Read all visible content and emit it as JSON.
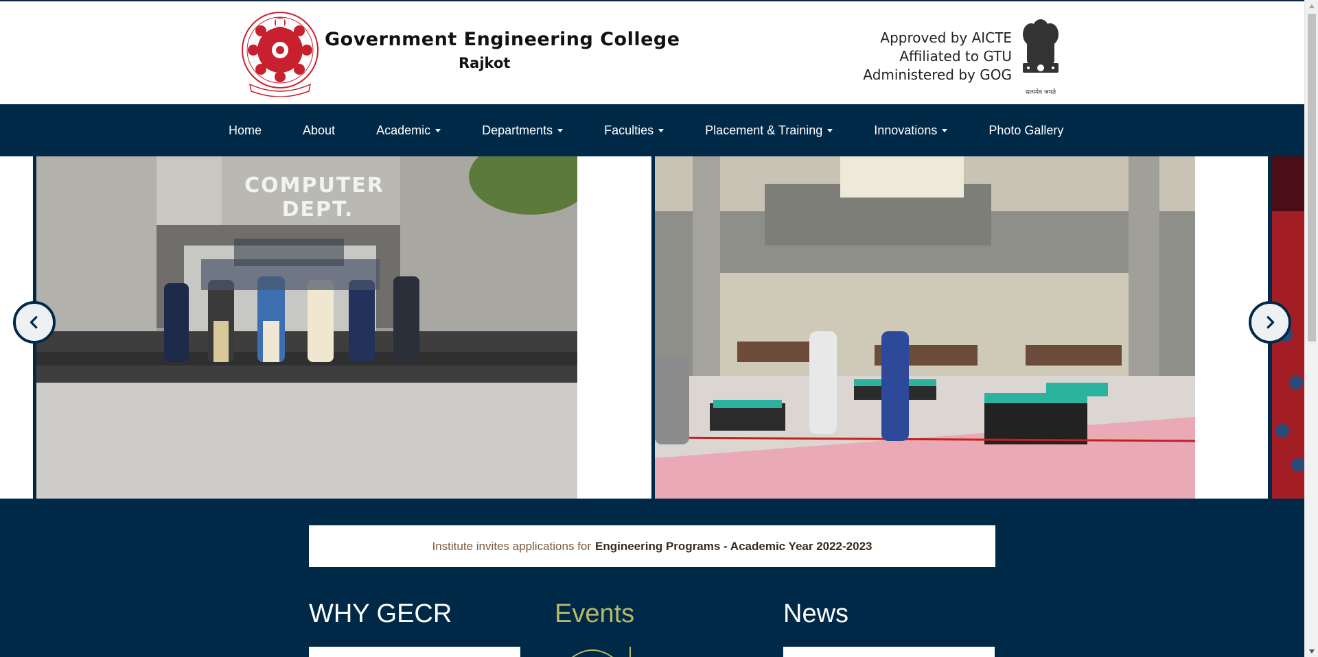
{
  "header": {
    "college_name": "Government Engineering College",
    "college_city": "Rajkot",
    "approvals": [
      "Approved by AICTE",
      "Affiliated to GTU",
      "Administered by GOG"
    ],
    "emblem_caption": "सत्यमेव जयते"
  },
  "nav": {
    "items": [
      {
        "label": "Home",
        "dropdown": false
      },
      {
        "label": "About",
        "dropdown": false
      },
      {
        "label": "Academic",
        "dropdown": true
      },
      {
        "label": "Departments",
        "dropdown": true
      },
      {
        "label": "Faculties",
        "dropdown": true
      },
      {
        "label": "Placement & Training",
        "dropdown": true
      },
      {
        "label": "Innovations",
        "dropdown": true
      },
      {
        "label": "Photo Gallery",
        "dropdown": false
      }
    ]
  },
  "slider": {
    "slide1_sign": [
      "COMPUTER",
      "DEPT."
    ],
    "prev_icon": "chevron-left-icon",
    "next_icon": "chevron-right-icon"
  },
  "notice": {
    "prefix": "Institute invites applications for",
    "highlight": "Engineering Programs - Academic Year 2022-2023"
  },
  "sections": {
    "why": "WHY GECR",
    "events": "Events",
    "news": "News"
  },
  "colors": {
    "navy": "#002948",
    "events_title": "#b7b86a",
    "logo_red": "#c8202f"
  }
}
